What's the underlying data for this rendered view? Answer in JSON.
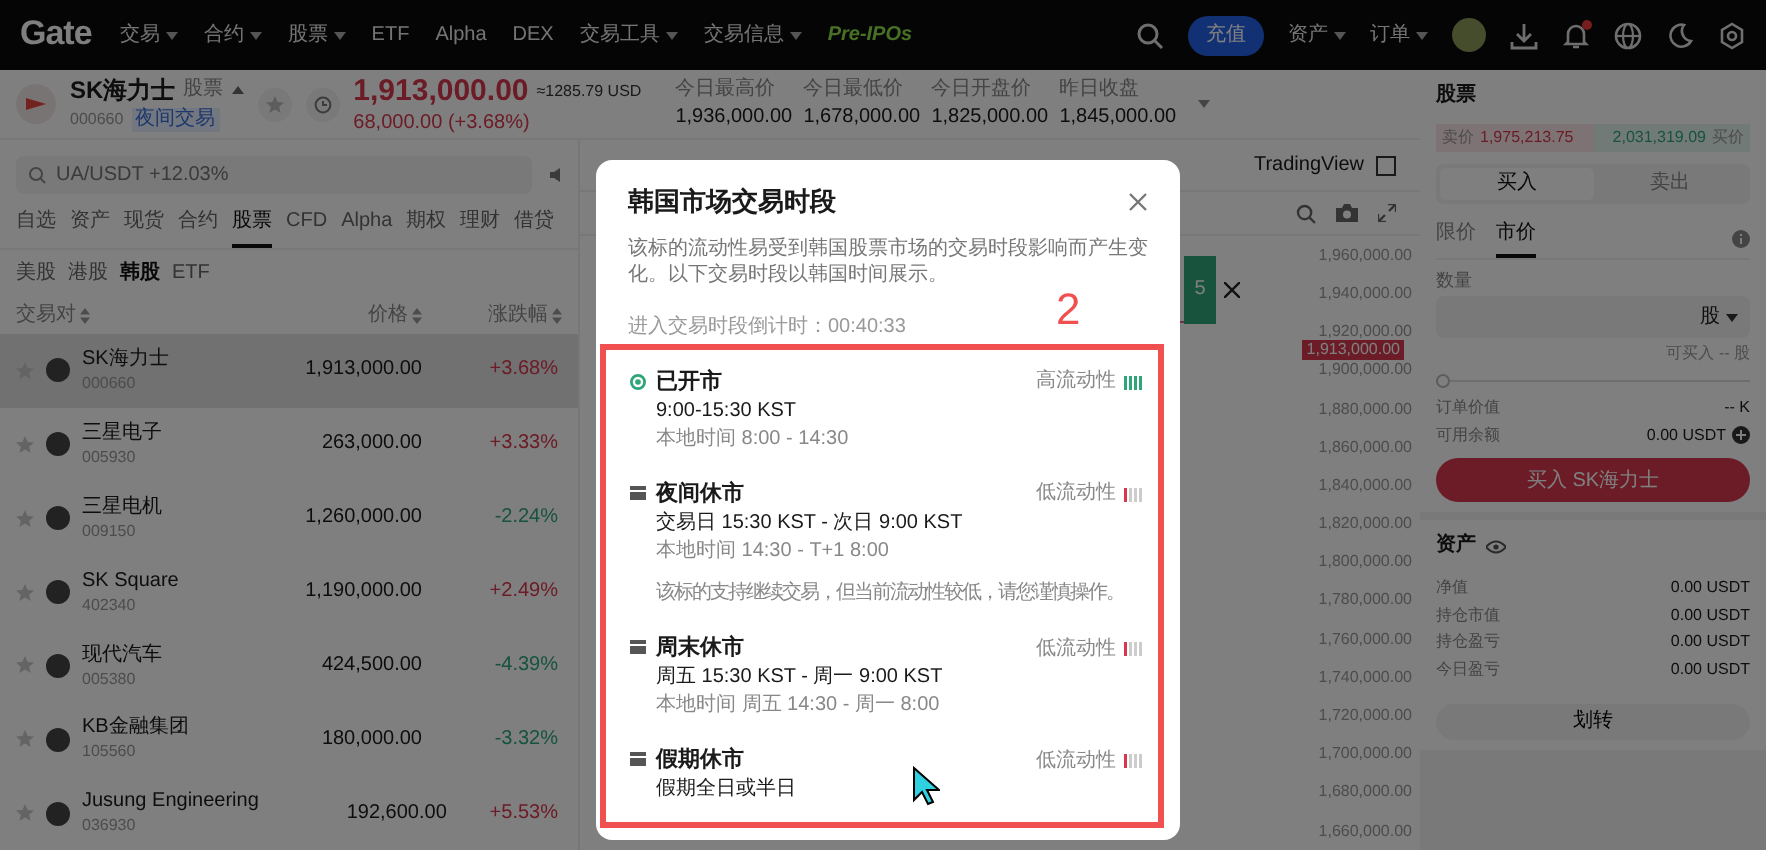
{
  "topbar": {
    "logo": "Gate",
    "nav": [
      {
        "label": "交易",
        "kind": "menu"
      },
      {
        "label": "合约",
        "kind": "menu"
      },
      {
        "label": "股票",
        "kind": "menu"
      },
      {
        "label": "ETF",
        "kind": "link"
      },
      {
        "label": "Alpha",
        "kind": "link"
      },
      {
        "label": "DEX",
        "kind": "link"
      },
      {
        "label": "交易工具",
        "kind": "menu"
      },
      {
        "label": "交易信息",
        "kind": "menu"
      },
      {
        "label": "Pre-IPOs",
        "kind": "promo"
      }
    ],
    "deposit_button": "充值",
    "menus": [
      "资产",
      "订单"
    ],
    "notification_dot": true
  },
  "stock_header": {
    "name": "SK海力士",
    "type_badge": "股票",
    "code": "000660",
    "session_tag": "夜间交易",
    "price": "1,913,000.00",
    "price_usd": "≈1285.79 USD",
    "change": "68,000.00 (+3.68%)",
    "stats": [
      {
        "label": "今日最高价",
        "value": "1,936,000.00"
      },
      {
        "label": "今日最低价",
        "value": "1,678,000.00"
      },
      {
        "label": "今日开盘价",
        "value": "1,825,000.00"
      },
      {
        "label": "昨日收盘",
        "value": "1,845,000.00"
      }
    ]
  },
  "market_list": {
    "search": {
      "placeholder": "UA/USDT +12.03%"
    },
    "tabs": [
      {
        "label": "自选",
        "selected": false
      },
      {
        "label": "资产",
        "selected": false
      },
      {
        "label": "现货",
        "selected": false
      },
      {
        "label": "合约",
        "selected": false
      },
      {
        "label": "股票",
        "selected": true
      },
      {
        "label": "CFD",
        "selected": false
      },
      {
        "label": "Alpha",
        "selected": false
      },
      {
        "label": "期权",
        "selected": false
      },
      {
        "label": "理财",
        "selected": false
      },
      {
        "label": "借贷",
        "selected": false
      }
    ],
    "subtabs": [
      {
        "label": "美股",
        "selected": false
      },
      {
        "label": "港股",
        "selected": false
      },
      {
        "label": "韩股",
        "selected": true
      },
      {
        "label": "ETF",
        "selected": false
      }
    ],
    "columns": [
      "交易对",
      "价格",
      "涨跌幅"
    ],
    "rows": [
      {
        "name": "SK海力士",
        "code": "000660",
        "price": "1,913,000.00",
        "change": "+3.68%",
        "rising": true,
        "selected": true
      },
      {
        "name": "三星电子",
        "code": "005930",
        "price": "263,000.00",
        "change": "+3.33%",
        "rising": true,
        "selected": false
      },
      {
        "name": "三星电机",
        "code": "009150",
        "price": "1,260,000.00",
        "change": "-2.24%",
        "rising": false,
        "selected": false
      },
      {
        "name": "SK Square",
        "code": "402340",
        "price": "1,190,000.00",
        "change": "+2.49%",
        "rising": true,
        "selected": false
      },
      {
        "name": "现代汽车",
        "code": "005380",
        "price": "424,500.00",
        "change": "-4.39%",
        "rising": false,
        "selected": false
      },
      {
        "name": "KB金融集团",
        "code": "105560",
        "price": "180,000.00",
        "change": "-3.32%",
        "rising": false,
        "selected": false
      },
      {
        "name": "Jusung Engineering",
        "code": "036930",
        "price": "192,600.00",
        "change": "+5.53%",
        "rising": true,
        "selected": false
      }
    ]
  },
  "chart": {
    "source_label": "TradingView",
    "source_checked": false,
    "popup_text": "5",
    "last_price": "1,913,000.00",
    "axis_labels": [
      "1,960,000.00",
      "1,940,000.00",
      "1,920,000.00",
      "1,900,000.00",
      "1,880,000.00",
      "1,860,000.00",
      "1,840,000.00",
      "1,820,000.00",
      "1,800,000.00",
      "1,780,000.00",
      "1,760,000.00",
      "1,740,000.00",
      "1,720,000.00",
      "1,700,000.00",
      "1,680,000.00",
      "1,660,000.00"
    ]
  },
  "trade_panel": {
    "title": "股票",
    "ask": {
      "label": "卖价",
      "value": "1,975,213.75"
    },
    "bid": {
      "value": "2,031,319.09",
      "label": "买价"
    },
    "sides": [
      {
        "label": "买入",
        "selected": true
      },
      {
        "label": "卖出",
        "selected": false
      }
    ],
    "order_types": [
      {
        "label": "限价",
        "selected": false
      },
      {
        "label": "市价",
        "selected": true
      }
    ],
    "quantity_label": "数量",
    "unit": "股",
    "available": "可买入 -- 股",
    "slider": {
      "level": 0
    },
    "summary": [
      {
        "label": "订单价值",
        "value": "-- K"
      },
      {
        "label": "可用余额",
        "value": "0.00 USDT"
      }
    ],
    "submit": "买入 SK海力士"
  },
  "assets": {
    "title": "资产",
    "rows": [
      {
        "label": "净值",
        "value": "0.00 USDT"
      },
      {
        "label": "持仓市值",
        "value": "0.00 USDT"
      },
      {
        "label": "持仓盈亏",
        "value": "0.00 USDT"
      },
      {
        "label": "今日盈亏",
        "value": "0.00 USDT"
      }
    ],
    "transfer_button": "划转"
  },
  "modal": {
    "title": "韩国市场交易时段",
    "description": "该标的流动性易受到韩国股票市场的交易时段影响而产生变化。以下交易时段以韩国时间展示。",
    "countdown": "进入交易时段倒计时：00:40:33",
    "sessions": [
      {
        "kind": "open",
        "title": "已开市",
        "time": "9:00-15:30 KST",
        "local": "本地时间 8:00 - 14:30",
        "liquidity": "高流动性"
      },
      {
        "kind": "closed",
        "title": "夜间休市",
        "time": "交易日 15:30 KST - 次日 9:00 KST",
        "local": "本地时间 14:30 - T+1 8:00",
        "note": "该标的支持继续交易，但当前流动性较低，请您谨慎操作。",
        "liquidity": "低流动性"
      },
      {
        "kind": "closed",
        "title": "周末休市",
        "time": "周五 15:30 KST - 周一 9:00 KST",
        "local": "本地时间 周五 14:30 - 周一 8:00",
        "liquidity": "低流动性"
      },
      {
        "kind": "closed",
        "title": "假期休市",
        "time": "假期全日或半日",
        "liquidity": "低流动性"
      }
    ]
  },
  "annotation": {
    "label": "2"
  }
}
